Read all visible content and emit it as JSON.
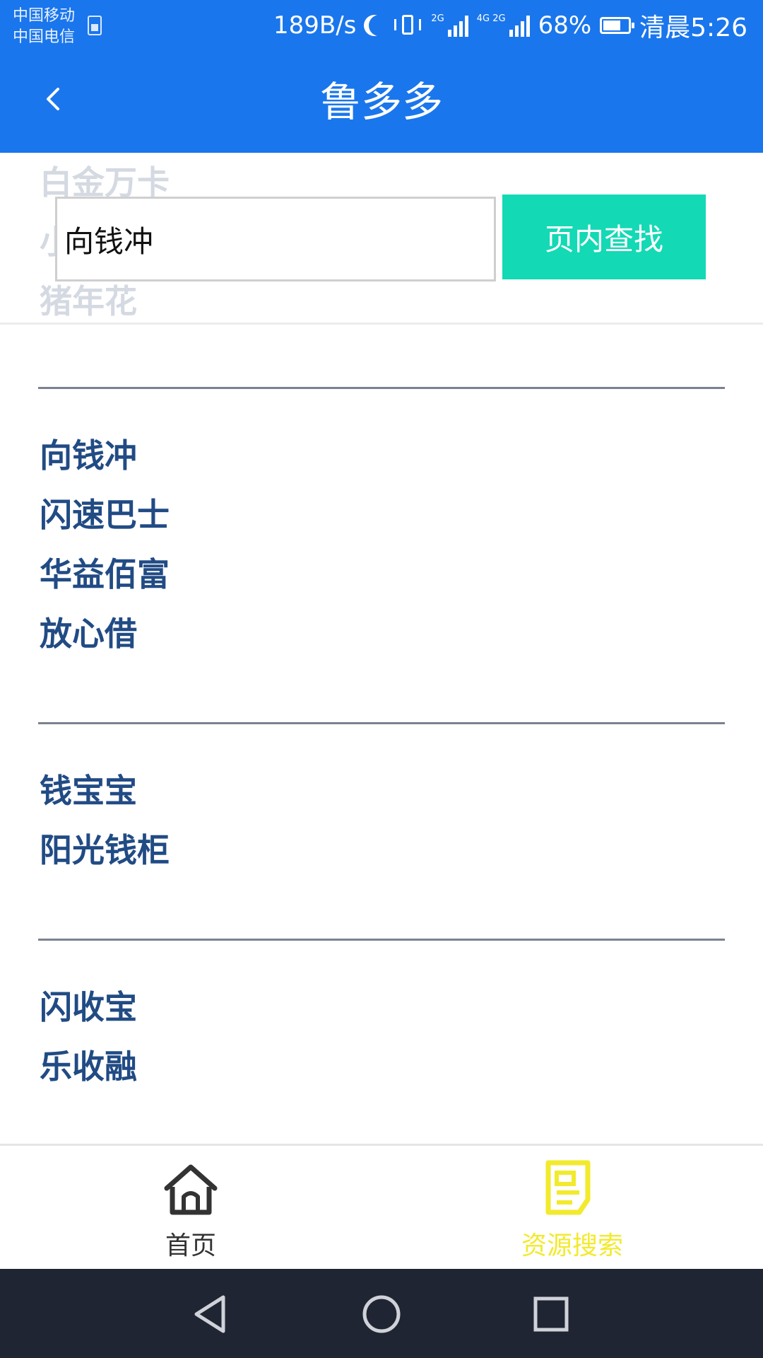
{
  "status_bar": {
    "carrier_1": "中国移动",
    "carrier_2": "中国电信",
    "net_speed": "189B/s",
    "signal_1_label": "2G",
    "signal_2_label": "4G 2G",
    "battery_percent": "68%",
    "time": "清晨5:26",
    "color": "#1a76ec"
  },
  "header": {
    "title": "鲁多多",
    "back_icon": "chevron-left-icon"
  },
  "faded_list": [
    "白金万卡",
    "小",
    "猪年花"
  ],
  "search": {
    "value": "向钱冲",
    "button_label": "页内查找",
    "button_color": "#13d9b5"
  },
  "groups": [
    {
      "items": [
        "向钱冲",
        "闪速巴士",
        "华益佰富",
        "放心借"
      ]
    },
    {
      "items": [
        "钱宝宝",
        "阳光钱柜"
      ]
    },
    {
      "items": [
        "闪收宝",
        "乐收融"
      ]
    }
  ],
  "bottom_nav": {
    "items": [
      {
        "label": "首页",
        "icon": "home-icon",
        "color": "#333333",
        "active": false
      },
      {
        "label": "资源搜索",
        "icon": "document-icon",
        "color": "#f2ea2c",
        "active": true
      }
    ]
  },
  "system_nav": {
    "buttons": [
      "back-triangle-icon",
      "home-circle-icon",
      "recents-square-icon"
    ]
  }
}
